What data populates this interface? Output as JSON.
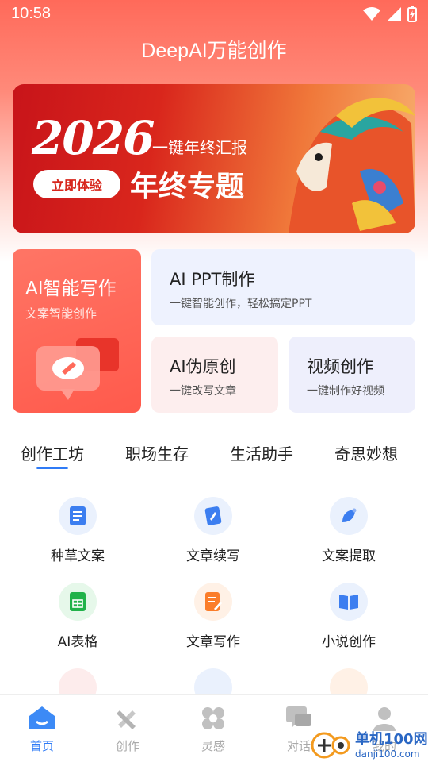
{
  "status": {
    "time": "10:58"
  },
  "header": {
    "title": "DeepAI万能创作"
  },
  "banner": {
    "year": "2026",
    "subtitle": "一键年终汇报",
    "button": "立即体验",
    "topic": "年终专题"
  },
  "cards": {
    "write": {
      "title": "AI智能写作",
      "subtitle": "文案智能创作"
    },
    "ppt": {
      "title": "AI PPT制作",
      "subtitle": "一键智能创作，轻松搞定PPT"
    },
    "pseudo": {
      "title": "AI伪原创",
      "subtitle": "一键改写文章"
    },
    "video": {
      "title": "视频创作",
      "subtitle": "一键制作好视频"
    }
  },
  "tabs": [
    "创作工坊",
    "职场生存",
    "生活助手",
    "奇思妙想"
  ],
  "grid": [
    {
      "label": "种草文案",
      "icon": "doc-icon",
      "bg": "#eaf1fd",
      "color": "#3c7ef0"
    },
    {
      "label": "文章续写",
      "icon": "pen-card-icon",
      "bg": "#eaf1fd",
      "color": "#3c7ef0"
    },
    {
      "label": "文案提取",
      "icon": "leaf-icon",
      "bg": "#eaf1fd",
      "color": "#3c7ef0"
    },
    {
      "label": "AI表格",
      "icon": "sheet-icon",
      "bg": "#e6f8ea",
      "color": "#21b24a"
    },
    {
      "label": "文章写作",
      "icon": "doc-edit-icon",
      "bg": "#fff1e6",
      "color": "#fb7d2a"
    },
    {
      "label": "小说创作",
      "icon": "book-icon",
      "bg": "#eaf1fd",
      "color": "#3c7ef0"
    }
  ],
  "nav": [
    {
      "label": "首页",
      "icon": "home-icon",
      "active": true
    },
    {
      "label": "创作",
      "icon": "tools-icon",
      "active": false
    },
    {
      "label": "灵感",
      "icon": "inspiration-icon",
      "active": false
    },
    {
      "label": "对话",
      "icon": "chat-icon",
      "active": false
    },
    {
      "label": "我的",
      "icon": "profile-icon",
      "active": false
    }
  ],
  "watermark": {
    "name": "单机100网",
    "url": "danji100.com"
  },
  "colors": {
    "accent": "#2f7bf6",
    "brand": "#ff5a4c"
  }
}
